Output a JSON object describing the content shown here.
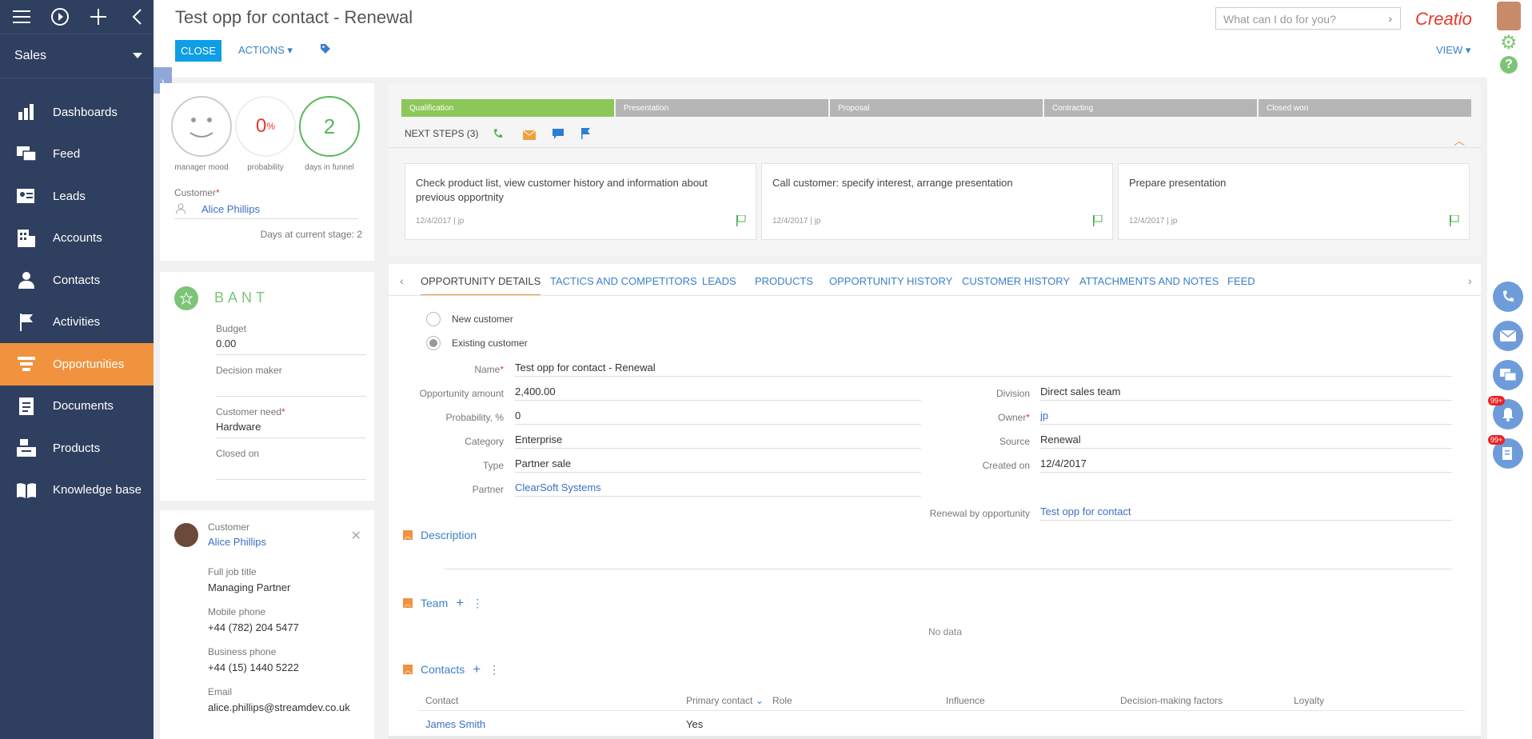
{
  "sidebar": {
    "workspace": "Sales",
    "items": [
      {
        "label": "Dashboards"
      },
      {
        "label": "Feed"
      },
      {
        "label": "Leads"
      },
      {
        "label": "Accounts"
      },
      {
        "label": "Contacts"
      },
      {
        "label": "Activities"
      },
      {
        "label": "Opportunities"
      },
      {
        "label": "Documents"
      },
      {
        "label": "Products"
      },
      {
        "label": "Knowledge base"
      }
    ]
  },
  "header": {
    "title": "Test opp for contact - Renewal",
    "close_label": "CLOSE",
    "actions_label": "ACTIONS",
    "search_placeholder": "What can I do for you?",
    "logo": "Creatio",
    "view_label": "VIEW"
  },
  "summary": {
    "mood_label": "manager mood",
    "probability_value": "0",
    "probability_unit": "%",
    "probability_label": "probability",
    "days_value": "2",
    "days_label": "days in funnel",
    "customer_label": "Customer",
    "customer_value": "Alice Phillips",
    "days_stage_label": "Days at current stage:",
    "days_stage_value": "2"
  },
  "bant": {
    "title": "BANT",
    "budget_label": "Budget",
    "budget_value": "0.00",
    "decision_label": "Decision maker",
    "need_label": "Customer need",
    "need_value": "Hardware",
    "closed_label": "Closed on"
  },
  "contact_card": {
    "role": "Customer",
    "name": "Alice Phillips",
    "job_label": "Full job title",
    "job_value": "Managing Partner",
    "mobile_label": "Mobile phone",
    "mobile_value": "+44 (782) 204 5477",
    "business_label": "Business phone",
    "business_value": "+44 (15) 1440 5222",
    "email_label": "Email",
    "email_value": "alice.phillips@streamdev.co.uk"
  },
  "stages": [
    "Qualification",
    "Presentation",
    "Proposal",
    "Contracting",
    "Closed won"
  ],
  "next_steps": {
    "label": "NEXT STEPS (3)",
    "cards": [
      {
        "text": "Check product list, view customer history and information about previous opportnity",
        "date": "12/4/2017",
        "owner": "jp"
      },
      {
        "text": "Call customer: specify interest, arrange presentation",
        "date": "12/4/2017",
        "owner": "jp"
      },
      {
        "text": "Prepare presentation",
        "date": "12/4/2017",
        "owner": "jp"
      }
    ]
  },
  "tabs": [
    "OPPORTUNITY DETAILS",
    "TACTICS AND COMPETITORS",
    "LEADS",
    "PRODUCTS",
    "OPPORTUNITY HISTORY",
    "CUSTOMER HISTORY",
    "ATTACHMENTS AND NOTES",
    "FEED"
  ],
  "details": {
    "new_customer": "New customer",
    "existing_customer": "Existing customer",
    "name_label": "Name",
    "name_value": "Test opp for contact - Renewal",
    "amount_label": "Opportunity amount",
    "amount_value": "2,400.00",
    "probability_label": "Probability, %",
    "probability_value": "0",
    "category_label": "Category",
    "category_value": "Enterprise",
    "type_label": "Type",
    "type_value": "Partner sale",
    "partner_label": "Partner",
    "partner_value": "ClearSoft Systems",
    "division_label": "Division",
    "division_value": "Direct sales team",
    "owner_label": "Owner",
    "owner_value": "jp",
    "source_label": "Source",
    "source_value": "Renewal",
    "created_label": "Created on",
    "created_value": "12/4/2017",
    "renewal_label": "Renewal by opportunity",
    "renewal_value": "Test opp for contact"
  },
  "sections": {
    "description": "Description",
    "team": "Team",
    "no_data": "No data",
    "contacts": "Contacts"
  },
  "contacts_table": {
    "headers": [
      "Contact",
      "Primary contact",
      "Role",
      "Influence",
      "Decision-making factors",
      "Loyalty"
    ],
    "row": {
      "contact": "James Smith",
      "primary": "Yes"
    }
  },
  "badges": {
    "notifications": "99+",
    "tasks": "99+"
  }
}
